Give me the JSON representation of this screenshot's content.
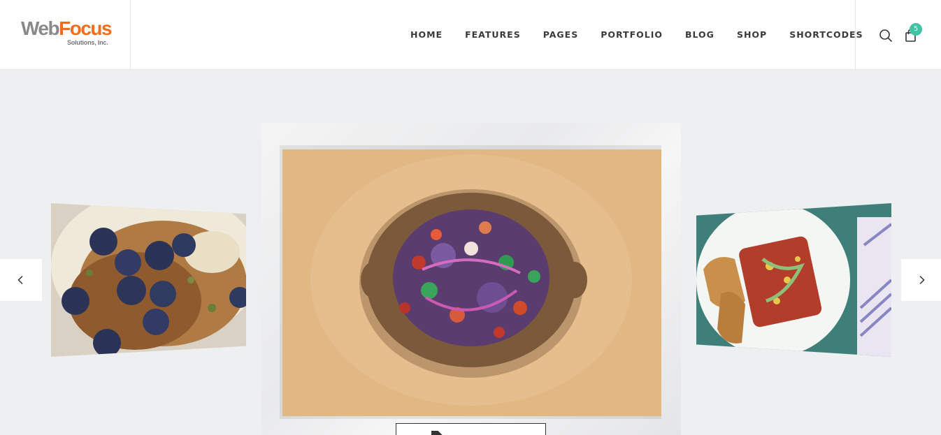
{
  "brand": {
    "logo_web": "Web",
    "logo_focus": "Focus",
    "logo_sub": "Solutions, Inc."
  },
  "nav": {
    "items": [
      {
        "label": "HOME"
      },
      {
        "label": "FEATURES"
      },
      {
        "label": "PAGES"
      },
      {
        "label": "PORTFOLIO"
      },
      {
        "label": "BLOG"
      },
      {
        "label": "SHOP"
      },
      {
        "label": "SHORTCODES"
      }
    ]
  },
  "utility": {
    "search_icon": "search-icon",
    "cart_icon": "shopping-bag-icon",
    "cart_count": "5"
  },
  "slider": {
    "prev_icon": "chevron-left-icon",
    "next_icon": "chevron-right-icon",
    "colors": {
      "accent": "#3ec3a3",
      "brand_orange": "#f26d1c",
      "background": "#eeeff1"
    }
  }
}
